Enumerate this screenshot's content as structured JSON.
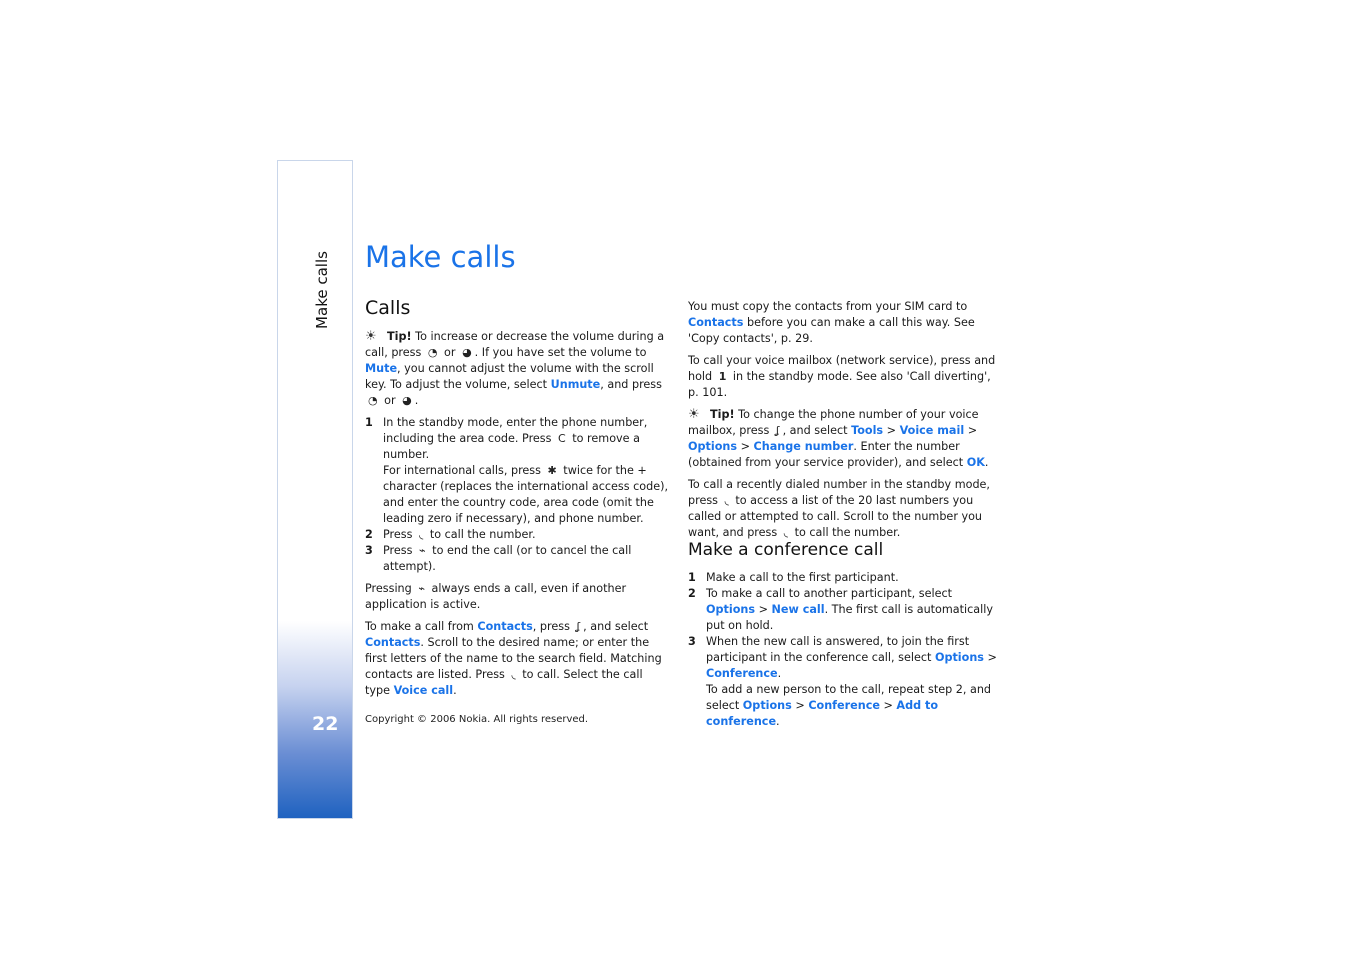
{
  "sidebar": {
    "label": "Make calls",
    "page_number": "22"
  },
  "title": "Make calls",
  "left": {
    "heading": "Calls",
    "tip": {
      "label": "Tip!",
      "t1": " To increase or decrease the volume during a call, press ",
      "or": " or ",
      "t2": ". If you have set the volume to ",
      "mute": "Mute",
      "t3": ", you cannot adjust the volume with the scroll key. To adjust the volume, select ",
      "unmute": "Unmute",
      "t4": ", and press ",
      "or2": " or ",
      "end": "."
    },
    "steps": [
      {
        "n": "1",
        "a": "In the standby mode, enter the phone number, including the area code. Press ",
        "b": " to remove a number.",
        "c": "For international calls, press ",
        "d": " twice for the + character (replaces the international access code), and enter the country code, area code (omit the leading zero if necessary), and phone number."
      },
      {
        "n": "2",
        "a": "Press ",
        "b": " to call the number."
      },
      {
        "n": "3",
        "a": "Press ",
        "b": " to end the call (or to cancel the call attempt)."
      }
    ],
    "pressing": {
      "a": "Pressing ",
      "b": " always ends a call, even if another application is active."
    },
    "contacts": {
      "a": "To make a call from ",
      "contacts": "Contacts",
      "b": ", press ",
      "c": ", and select ",
      "contacts2": "Contacts",
      "d": ". Scroll to the desired name; or enter the first letters of the name to the search field. Matching contacts are listed. Press ",
      "e": " to call. Select the call type ",
      "voice": "Voice call",
      "f": "."
    }
  },
  "right": {
    "copy": {
      "a": "You must copy the contacts from your SIM card to ",
      "contacts": "Contacts",
      "b": " before you can make a call this way. See 'Copy contacts', p. 29."
    },
    "mailbox": {
      "a": "To call your voice mailbox (network service), press and hold ",
      "key": "1",
      "b": " in the standby mode. See also 'Call diverting', p. 101."
    },
    "tip": {
      "label": "Tip!",
      "a": " To change the phone number of your voice mailbox, press ",
      "b": ", and select ",
      "tools": "Tools",
      "gt": " > ",
      "voice": "Voice mail",
      "options": "Options",
      "change": "Change number",
      "c": ". Enter the number (obtained from your service provider), and select ",
      "ok": "OK",
      "d": "."
    },
    "recent": {
      "a": "To call a recently dialed number in the standby mode, press ",
      "b": " to access a list of the 20 last numbers you called or attempted to call. Scroll to the number you want, and press ",
      "c": " to call the number."
    },
    "conf_heading": "Make a conference call",
    "conf_steps": {
      "s1": {
        "n": "1",
        "a": "Make a call to the first participant."
      },
      "s2": {
        "n": "2",
        "a": "To make a call to another participant, select ",
        "options": "Options",
        "gt": " > ",
        "newcall": "New call",
        "b": ". The first call is automatically put on hold."
      },
      "s3": {
        "n": "3",
        "a": "When the new call is answered, to join the first participant in the conference call, select ",
        "options": "Options",
        "gt": " > ",
        "conference": "Conference",
        "b": ".",
        "c": "To add a new person to the call, repeat step 2, and select ",
        "options2": "Options",
        "conference2": "Conference",
        "add": "Add to conference",
        "d": "."
      }
    }
  },
  "copyright": "Copyright © 2006 Nokia. All rights reserved.",
  "icons": {
    "vol_up": "◔",
    "vol_down": "◕",
    "clear": "C",
    "star": "✱",
    "call": "◟",
    "end": "⌁",
    "menu": "ʆ",
    "bulb": "☀"
  }
}
